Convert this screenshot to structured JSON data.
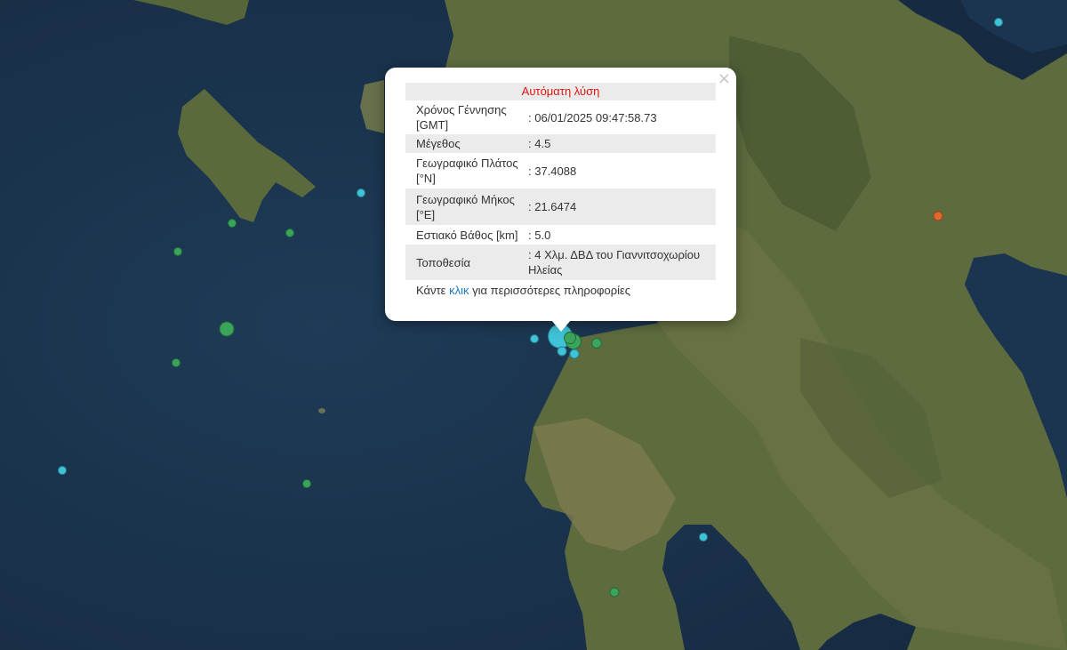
{
  "popup": {
    "close_label": "×",
    "header": "Αυτόματη λύση",
    "rows": [
      {
        "label": "Χρόνος Γέννησης [GMT]",
        "value": ": 06/01/2025 09:47:58.73"
      },
      {
        "label": "Μέγεθος",
        "value": ": 4.5"
      },
      {
        "label": "Γεωγραφικό Πλάτος [°N]",
        "value": ": 37.4088"
      },
      {
        "label": "Γεωγραφικό Μήκος [°E]",
        "value": ": 21.6474"
      },
      {
        "label": "Εστιακό Βάθος [km]",
        "value": ": 5.0"
      },
      {
        "label": "Τοποθεσία",
        "value": ": 4 Χλμ. ΔΒΔ του Γιαννιτσοχωρίου Ηλείας"
      }
    ],
    "more_prefix": "Κάντε ",
    "more_link": "κλικ",
    "more_suffix": " για περισσότερες πληροφορίες"
  },
  "colors": {
    "cyan": "#3ec3d8",
    "green": "#3aa45a",
    "orange": "#e3692a",
    "header_text": "#e0140f",
    "link": "#1a78c2"
  },
  "legend_note": "marker color groups: cyan, green, orange"
}
